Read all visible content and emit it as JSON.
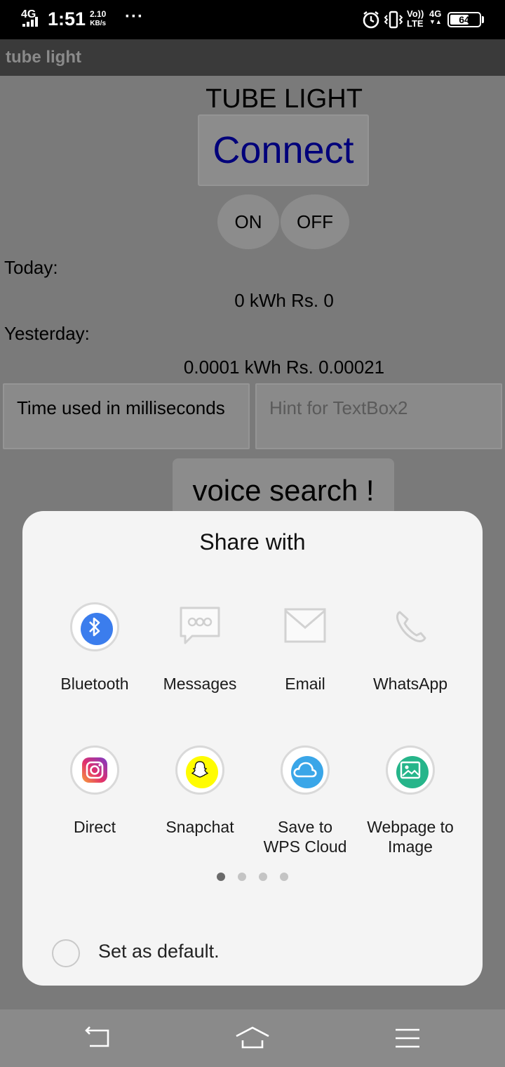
{
  "status_bar": {
    "network": "4G",
    "time": "1:51",
    "speed_value": "2.10",
    "speed_unit": "KB/s",
    "overflow": "···",
    "volte_top": "Vo))",
    "volte_bottom": "LTE",
    "network2": "4G",
    "battery_level": "64",
    "battery_fraction": 0.64
  },
  "app_bar": {
    "title": "tube light"
  },
  "app": {
    "heading": "TUBE LIGHT",
    "connect_label": "Connect",
    "on_label": "ON",
    "off_label": "OFF",
    "today_label": "Today:",
    "today_value": "0 kWh Rs. 0",
    "yesterday_label": "Yesterday:",
    "yesterday_value": "0.0001 kWh Rs. 0.00021",
    "textbox1_value": "Time used in milliseconds",
    "textbox2_placeholder": "Hint for TextBox2",
    "voice_label": "voice search !"
  },
  "share_sheet": {
    "title": "Share with",
    "options": [
      {
        "label": "Bluetooth",
        "icon": "bluetooth-icon"
      },
      {
        "label": "Messages",
        "icon": "messages-icon"
      },
      {
        "label": "Email",
        "icon": "email-icon"
      },
      {
        "label": "WhatsApp",
        "icon": "whatsapp-phone-icon"
      },
      {
        "label": "Direct",
        "icon": "instagram-icon"
      },
      {
        "label": "Snapchat",
        "icon": "snapchat-icon"
      },
      {
        "label": "Save to\nWPS Cloud",
        "icon": "cloud-icon"
      },
      {
        "label": "Webpage to\nImage",
        "icon": "image-icon"
      }
    ],
    "page_count": 4,
    "active_page": 1,
    "default_label": "Set as default."
  },
  "nav_bar": {
    "back_icon": "back-icon",
    "home_icon": "home-icon",
    "menu_icon": "menu-icon"
  },
  "colors": {
    "bluetooth": "#3b7ded",
    "snapchat": "#fffc00",
    "wps_cloud": "#3aa6e8",
    "image_green": "#26b58a",
    "connect_text": "#00007a"
  }
}
